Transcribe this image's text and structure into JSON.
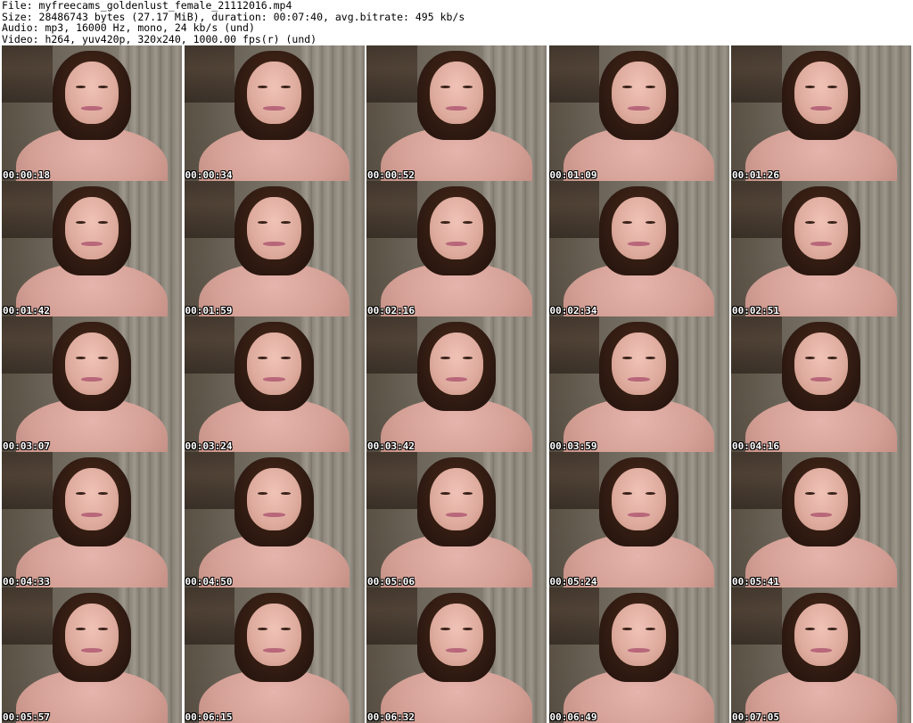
{
  "header": {
    "line1": "File: myfreecams_goldenlust_female_21112016.mp4",
    "line2": "Size: 28486743 bytes (27.17 MiB), duration: 00:07:40, avg.bitrate: 495 kb/s",
    "line3": "Audio: mp3, 16000 Hz, mono, 24 kb/s (und)",
    "line4": "Video: h264, yuv420p, 320x240, 1000.00 fps(r) (und)"
  },
  "thumbnails": [
    "00:00:18",
    "00:00:34",
    "00:00:52",
    "00:01:09",
    "00:01:26",
    "00:01:42",
    "00:01:59",
    "00:02:16",
    "00:02:34",
    "00:02:51",
    "00:03:07",
    "00:03:24",
    "00:03:42",
    "00:03:59",
    "00:04:16",
    "00:04:33",
    "00:04:50",
    "00:05:06",
    "00:05:24",
    "00:05:41",
    "00:05:57",
    "00:06:15",
    "00:06:32",
    "00:06:49",
    "00:07:05"
  ]
}
